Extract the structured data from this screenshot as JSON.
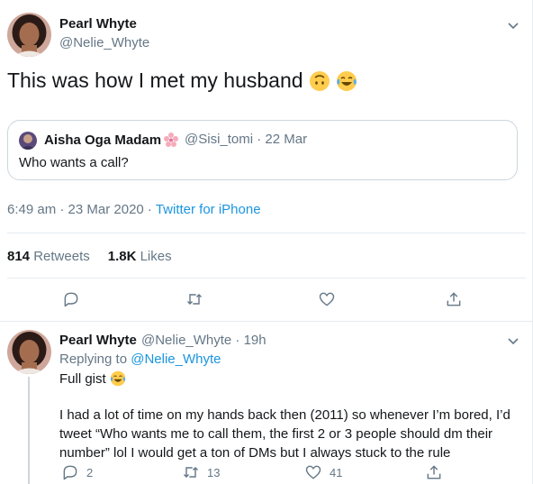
{
  "tweet": {
    "author_name": "Pearl Whyte",
    "author_handle": "@Nelie_Whyte",
    "text": "This was how I met my husband",
    "emojis": [
      "upside-down-face",
      "tears-of-joy"
    ],
    "timestamp": "6:49 am · 23 Mar 2020 · ",
    "source": "Twitter for iPhone",
    "retweets_count": "814",
    "retweets_label": "Retweets",
    "likes_count": "1.8K",
    "likes_label": "Likes"
  },
  "quoted": {
    "author_name": "Aisha Oga Madam",
    "badge_emoji": "cherry-blossom",
    "handle_and_time": "@Sisi_tomi · 22 Mar",
    "text": "Who wants a call?"
  },
  "actions": [
    "reply-icon",
    "retweet-icon",
    "like-icon",
    "share-icon"
  ],
  "reply": {
    "author_name": "Pearl Whyte",
    "handle_and_time": "@Nelie_Whyte · 19h",
    "replying_prefix": "Replying to ",
    "replying_handle": "@Nelie_Whyte",
    "first_line": "Full gist",
    "body": "I had a lot of time on my hands back then (2011) so whenever I’m bored, I’d tweet “Who wants me to call them, the first 2 or 3 people should dm their number” lol I would get a ton of DMs but I always stuck to the rule",
    "reply_count": "2",
    "retweet_count": "13",
    "like_count": "41"
  },
  "colors": {
    "text": "#14171a",
    "muted": "#657786",
    "link": "#1b95e0",
    "border": "#e6ecf0"
  }
}
